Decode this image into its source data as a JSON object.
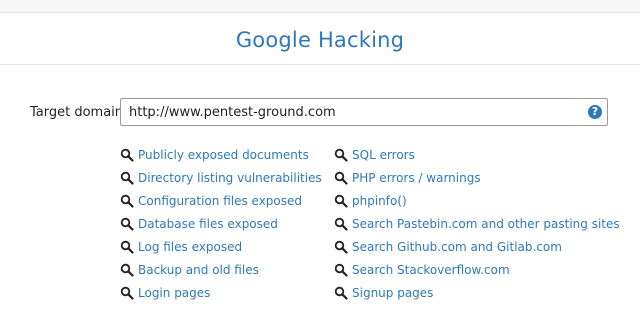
{
  "page": {
    "title": "Google Hacking"
  },
  "target": {
    "label": "Target domain",
    "value": "http://www.pentest-ground.com",
    "help_icon": "question-circle-icon",
    "help_glyph": "?"
  },
  "links_left": [
    {
      "label": "Publicly exposed documents",
      "icon": "search-icon"
    },
    {
      "label": "Directory listing vulnerabilities",
      "icon": "search-icon"
    },
    {
      "label": "Configuration files exposed",
      "icon": "search-icon"
    },
    {
      "label": "Database files exposed",
      "icon": "search-icon"
    },
    {
      "label": "Log files exposed",
      "icon": "search-icon"
    },
    {
      "label": "Backup and old files",
      "icon": "search-icon"
    },
    {
      "label": "Login pages",
      "icon": "search-icon"
    }
  ],
  "links_right": [
    {
      "label": "SQL errors",
      "icon": "search-icon"
    },
    {
      "label": "PHP errors / warnings",
      "icon": "search-icon"
    },
    {
      "label": "phpinfo()",
      "icon": "search-icon"
    },
    {
      "label": "Search Pastebin.com and other pasting sites",
      "icon": "search-icon"
    },
    {
      "label": "Search Github.com and Gitlab.com",
      "icon": "search-icon"
    },
    {
      "label": "Search Stackoverflow.com",
      "icon": "search-icon"
    },
    {
      "label": "Signup pages",
      "icon": "search-icon"
    }
  ],
  "colors": {
    "accent": "#2f79b9",
    "text": "#222222",
    "icon": "#222222"
  }
}
